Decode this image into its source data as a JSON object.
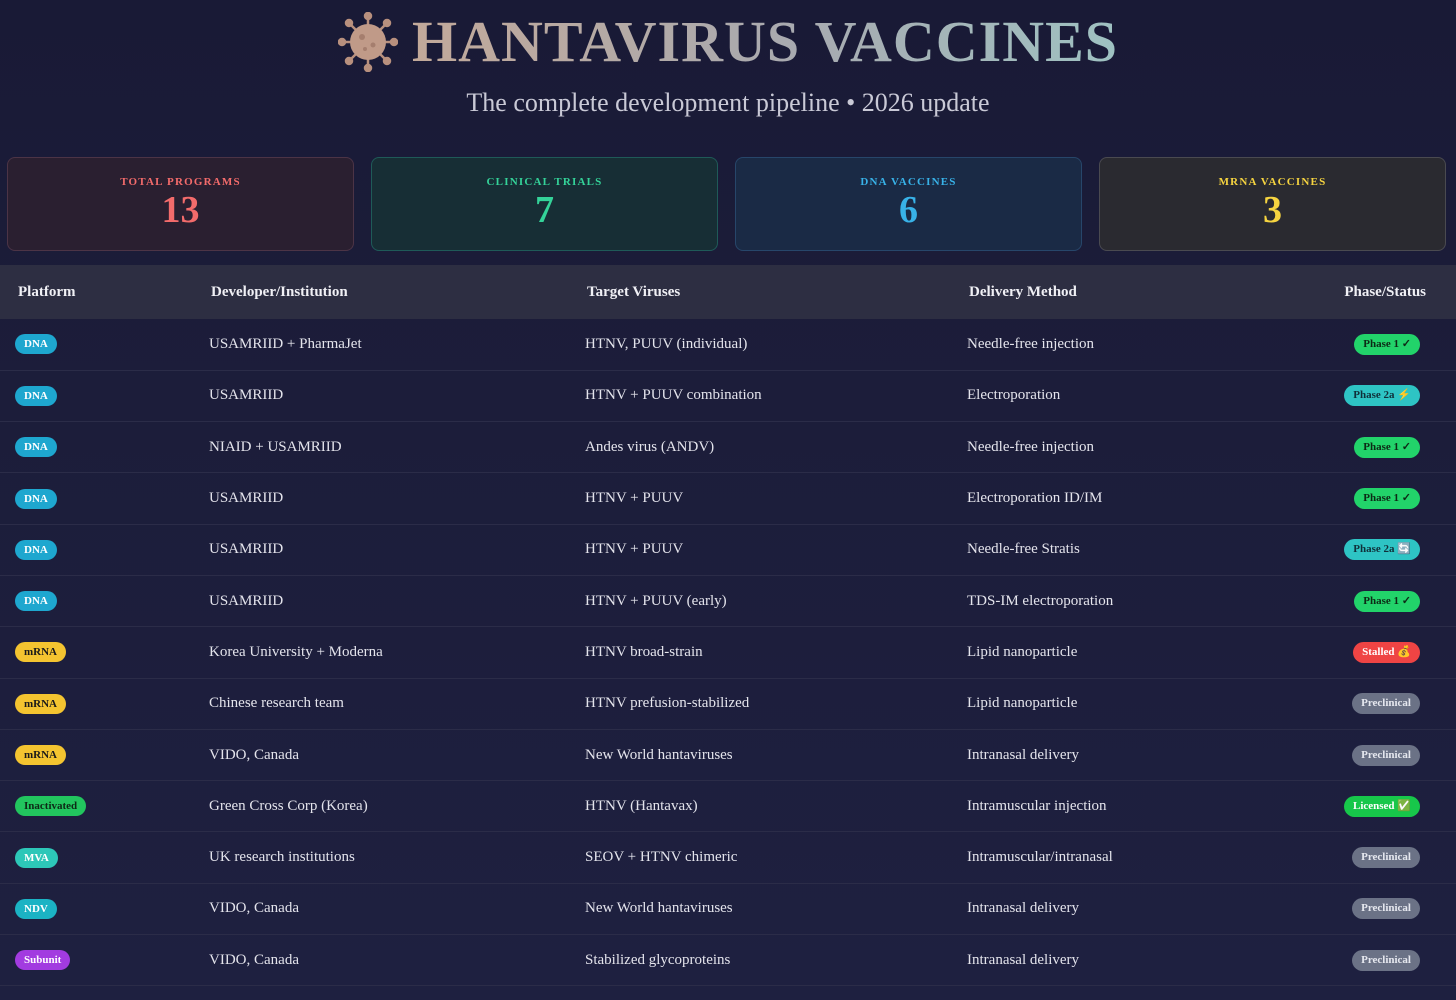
{
  "header": {
    "title": "HANTAVIRUS VACCINES",
    "subtitle": "The complete development pipeline • 2026 update",
    "icon": "virus-icon"
  },
  "stats": [
    {
      "label": "TOTAL PROGRAMS",
      "value": "13",
      "color": "#f36b6b"
    },
    {
      "label": "CLINICAL TRIALS",
      "value": "7",
      "color": "#34d399"
    },
    {
      "label": "DNA VACCINES",
      "value": "6",
      "color": "#38b2e8"
    },
    {
      "label": "MRNA VACCINES",
      "value": "3",
      "color": "#f6d440"
    }
  ],
  "table": {
    "headers": [
      "Platform",
      "Developer/Institution",
      "Target Viruses",
      "Delivery Method",
      "Phase/Status"
    ],
    "rows": [
      {
        "platform": "DNA",
        "developer": "USAMRIID + PharmaJet",
        "target": "HTNV, PUUV (individual)",
        "delivery": "Needle-free injection",
        "status": "Phase 1 ✓"
      },
      {
        "platform": "DNA",
        "developer": "USAMRIID",
        "target": "HTNV + PUUV combination",
        "delivery": "Electroporation",
        "status": "Phase 2a ⚡"
      },
      {
        "platform": "DNA",
        "developer": "NIAID + USAMRIID",
        "target": "Andes virus (ANDV)",
        "delivery": "Needle-free injection",
        "status": "Phase 1 ✓"
      },
      {
        "platform": "DNA",
        "developer": "USAMRIID",
        "target": "HTNV + PUUV",
        "delivery": "Electroporation ID/IM",
        "status": "Phase 1 ✓"
      },
      {
        "platform": "DNA",
        "developer": "USAMRIID",
        "target": "HTNV + PUUV",
        "delivery": "Needle-free Stratis",
        "status": "Phase 2a 🔄"
      },
      {
        "platform": "DNA",
        "developer": "USAMRIID",
        "target": "HTNV + PUUV (early)",
        "delivery": "TDS-IM electroporation",
        "status": "Phase 1 ✓"
      },
      {
        "platform": "mRNA",
        "developer": "Korea University + Moderna",
        "target": "HTNV broad-strain",
        "delivery": "Lipid nanoparticle",
        "status": "Stalled 💰"
      },
      {
        "platform": "mRNA",
        "developer": "Chinese research team",
        "target": "HTNV prefusion-stabilized",
        "delivery": "Lipid nanoparticle",
        "status": "Preclinical"
      },
      {
        "platform": "mRNA",
        "developer": "VIDO, Canada",
        "target": "New World hantaviruses",
        "delivery": "Intranasal delivery",
        "status": "Preclinical"
      },
      {
        "platform": "Inactivated",
        "developer": "Green Cross Corp (Korea)",
        "target": "HTNV (Hantavax)",
        "delivery": "Intramuscular injection",
        "status": "Licensed ✅"
      },
      {
        "platform": "MVA",
        "developer": "UK research institutions",
        "target": "SEOV + HTNV chimeric",
        "delivery": "Intramuscular/intranasal",
        "status": "Preclinical"
      },
      {
        "platform": "NDV",
        "developer": "VIDO, Canada",
        "target": "New World hantaviruses",
        "delivery": "Intranasal delivery",
        "status": "Preclinical"
      },
      {
        "platform": "Subunit",
        "developer": "VIDO, Canada",
        "target": "Stabilized glycoproteins",
        "delivery": "Intranasal delivery",
        "status": "Preclinical"
      }
    ]
  }
}
